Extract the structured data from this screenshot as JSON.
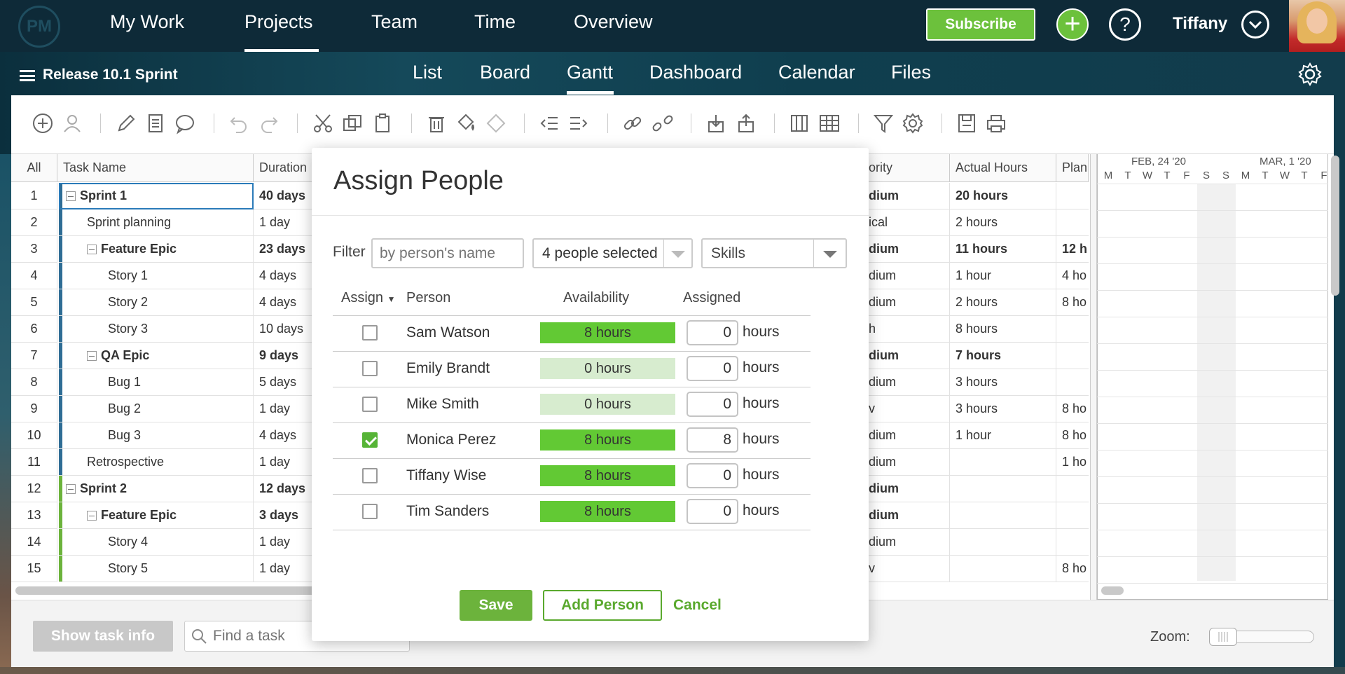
{
  "topnav": {
    "logo": "PM",
    "items": [
      "My Work",
      "Projects",
      "Team",
      "Time",
      "Overview"
    ],
    "subscribe_label": "Subscribe",
    "user_name": "Tiffany"
  },
  "subnav": {
    "project_title": "Release 10.1 Sprint",
    "views": [
      "List",
      "Board",
      "Gantt",
      "Dashboard",
      "Calendar",
      "Files"
    ],
    "active_view": "Gantt"
  },
  "grid": {
    "headers": {
      "all": "All",
      "task_name": "Task Name",
      "duration": "Duration",
      "priority": "ority",
      "actual_hours": "Actual Hours",
      "planned": "Plan"
    },
    "rows": [
      {
        "num": "1",
        "name": "Sprint 1",
        "duration": "40 days",
        "priority": "dium",
        "actual": "20 hours",
        "planned": "",
        "bold": true
      },
      {
        "num": "2",
        "name": "Sprint planning",
        "duration": "1 day",
        "priority": "ical",
        "actual": "2 hours",
        "planned": "",
        "bold": false
      },
      {
        "num": "3",
        "name": "Feature Epic",
        "duration": "23 days",
        "priority": "dium",
        "actual": "11 hours",
        "planned": "12 h",
        "bold": true
      },
      {
        "num": "4",
        "name": "Story 1",
        "duration": "4 days",
        "priority": "dium",
        "actual": "1 hour",
        "planned": "4 ho",
        "bold": false
      },
      {
        "num": "5",
        "name": "Story 2",
        "duration": "4 days",
        "priority": "dium",
        "actual": "2 hours",
        "planned": "8 ho",
        "bold": false
      },
      {
        "num": "6",
        "name": "Story 3",
        "duration": "10 days",
        "priority": "h",
        "actual": "8 hours",
        "planned": "",
        "bold": false
      },
      {
        "num": "7",
        "name": "QA Epic",
        "duration": "9 days",
        "priority": "dium",
        "actual": "7 hours",
        "planned": "",
        "bold": true
      },
      {
        "num": "8",
        "name": "Bug 1",
        "duration": "5 days",
        "priority": "dium",
        "actual": "3 hours",
        "planned": "",
        "bold": false
      },
      {
        "num": "9",
        "name": "Bug 2",
        "duration": "1 day",
        "priority": "v",
        "actual": "3 hours",
        "planned": "8 ho",
        "bold": false
      },
      {
        "num": "10",
        "name": "Bug 3",
        "duration": "4 days",
        "priority": "dium",
        "actual": "1 hour",
        "planned": "8 ho",
        "bold": false
      },
      {
        "num": "11",
        "name": "Retrospective",
        "duration": "1 day",
        "priority": "dium",
        "actual": "",
        "planned": "1 ho",
        "bold": false
      },
      {
        "num": "12",
        "name": "Sprint 2",
        "duration": "12 days",
        "priority": "dium",
        "actual": "",
        "planned": "",
        "bold": true
      },
      {
        "num": "13",
        "name": "Feature Epic",
        "duration": "3 days",
        "priority": "dium",
        "actual": "",
        "planned": "",
        "bold": true
      },
      {
        "num": "14",
        "name": "Story 4",
        "duration": "1 day",
        "priority": "dium",
        "actual": "",
        "planned": "",
        "bold": false
      },
      {
        "num": "15",
        "name": "Story 5",
        "duration": "1 day",
        "priority": "v",
        "actual": "",
        "planned": "8 ho",
        "bold": false
      }
    ]
  },
  "gantt": {
    "week1_label": "FEB, 24 '20",
    "week2_label": "MAR, 1 '20",
    "days": [
      "M",
      "T",
      "W",
      "T",
      "F",
      "S",
      "S",
      "M",
      "T",
      "W",
      "T",
      "F"
    ]
  },
  "bottom": {
    "show_task_info": "Show task info",
    "find_placeholder": "Find a task",
    "zoom_label": "Zoom:"
  },
  "modal": {
    "title": "Assign People",
    "filter_label": "Filter",
    "filter_placeholder": "by person's name",
    "people_selected": "4 people selected",
    "skills": "Skills",
    "col_assign": "Assign",
    "col_person": "Person",
    "col_availability": "Availability",
    "col_assigned": "Assigned",
    "unit": "hours",
    "people": [
      {
        "name": "Sam Watson",
        "availability": "8 hours",
        "assigned": "0",
        "checked": false,
        "avail_full": true
      },
      {
        "name": "Emily Brandt",
        "availability": "0 hours",
        "assigned": "0",
        "checked": false,
        "avail_full": false
      },
      {
        "name": "Mike Smith",
        "availability": "0 hours",
        "assigned": "0",
        "checked": false,
        "avail_full": false
      },
      {
        "name": "Monica Perez",
        "availability": "8 hours",
        "assigned": "8",
        "checked": true,
        "avail_full": true
      },
      {
        "name": "Tiffany Wise",
        "availability": "8 hours",
        "assigned": "0",
        "checked": false,
        "avail_full": true
      },
      {
        "name": "Tim Sanders",
        "availability": "8 hours",
        "assigned": "0",
        "checked": false,
        "avail_full": true
      }
    ],
    "save_label": "Save",
    "add_person_label": "Add Person",
    "cancel_label": "Cancel"
  }
}
